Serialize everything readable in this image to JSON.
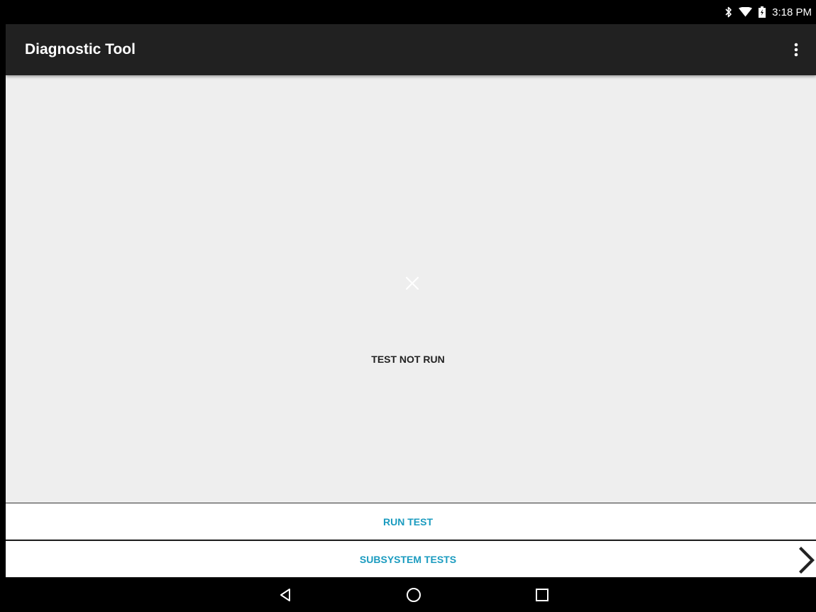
{
  "status_bar": {
    "time": "3:18 PM",
    "icons": [
      "bluetooth-icon",
      "wifi-icon",
      "battery-charging-icon"
    ]
  },
  "app_bar": {
    "title": "Diagnostic Tool",
    "menu_icon": "more-vert-icon"
  },
  "main": {
    "status_icon": "close-icon",
    "status_text": "TEST NOT RUN"
  },
  "actions": {
    "run_test_label": "RUN TEST",
    "subsystem_tests_label": "SUBSYSTEM TESTS",
    "subsystem_chevron_icon": "chevron-right-icon"
  },
  "nav_bar": {
    "buttons": [
      "back-icon",
      "home-icon",
      "recents-icon"
    ]
  },
  "colors": {
    "app_bar_bg": "#212121",
    "content_bg": "#eeeeee",
    "accent": "#1a9bbf"
  }
}
